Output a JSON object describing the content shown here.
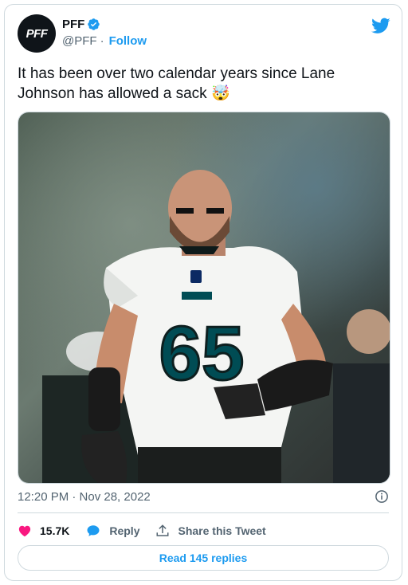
{
  "account": {
    "name": "PFF",
    "avatar_text": "PFF",
    "handle": "@PFF",
    "separator": "·",
    "follow_label": "Follow"
  },
  "tweet": {
    "text": "It has been over two calendar years since Lane Johnson has allowed a sack",
    "emoji": "🤯"
  },
  "media": {
    "jersey_number": "65"
  },
  "meta": {
    "timestamp": "12:20 PM · Nov 28, 2022"
  },
  "actions": {
    "likes": "15.7K",
    "reply_label": "Reply",
    "share_label": "Share this Tweet"
  },
  "replies_button": {
    "label": "Read 145 replies"
  },
  "colors": {
    "accent": "#1d9bf0",
    "like": "#f91880",
    "text": "#0f1419",
    "secondary": "#536471"
  }
}
